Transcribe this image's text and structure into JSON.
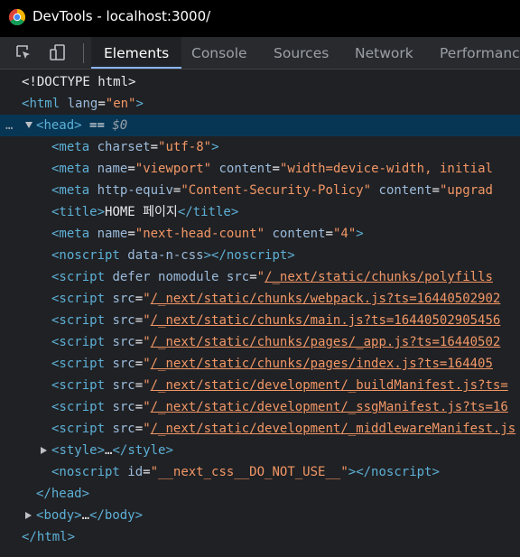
{
  "window": {
    "title": "DevTools - localhost:3000/"
  },
  "toolbar": {
    "inspect_icon": "inspect-cursor-icon",
    "device_icon": "device-toggle-icon",
    "tabs": [
      {
        "label": "Elements",
        "active": true
      },
      {
        "label": "Console",
        "active": false
      },
      {
        "label": "Sources",
        "active": false
      },
      {
        "label": "Network",
        "active": false
      },
      {
        "label": "Performance",
        "active": false
      }
    ]
  },
  "colors": {
    "tag": "#5db0d7",
    "attribute_name": "#9bbbdc",
    "attribute_value": "#f29766",
    "selected_row": "#073655",
    "active_tab_underline": "#8ab4f8"
  },
  "dom": {
    "doctype": "<!DOCTYPE html>",
    "html_open": {
      "tag": "html",
      "attr": "lang",
      "val": "en"
    },
    "head_open": {
      "tag": "head",
      "suffix": " == ",
      "ref": "$0",
      "dots": "…"
    },
    "meta_charset": {
      "attr": "charset",
      "val": "utf-8"
    },
    "meta_viewport": {
      "attr1": "name",
      "val1": "viewport",
      "attr2": "content",
      "val2": "width=device-width, initial"
    },
    "meta_csp": {
      "attr1": "http-equiv",
      "val1": "Content-Security-Policy",
      "attr2": "content",
      "val2": "upgrad"
    },
    "title": {
      "text": "HOME 페이지"
    },
    "meta_count": {
      "attr1": "name",
      "val1": "next-head-count",
      "attr2": "content",
      "val2": "4"
    },
    "noscript1": {
      "attr": "data-n-css"
    },
    "script_polyfills": {
      "attrs": "defer nomodule",
      "src": "/_next/static/chunks/polyfills"
    },
    "scripts": [
      "/_next/static/chunks/webpack.js?ts=16440502902",
      "/_next/static/chunks/main.js?ts=16440502905456",
      "/_next/static/chunks/pages/_app.js?ts=16440502",
      "/_next/static/chunks/pages/index.js?ts=164405",
      "/_next/static/development/_buildManifest.js?ts=",
      "/_next/static/development/_ssgManifest.js?ts=16",
      "/_next/static/development/_middlewareManifest.js"
    ],
    "style_collapsed": {
      "tag": "style",
      "ellipsis": "…"
    },
    "noscript2": {
      "attr": "id",
      "val": "__next_css__DO_NOT_USE__"
    },
    "head_close": "head",
    "body_collapsed": {
      "tag": "body",
      "ellipsis": "…"
    },
    "html_close": "html"
  }
}
